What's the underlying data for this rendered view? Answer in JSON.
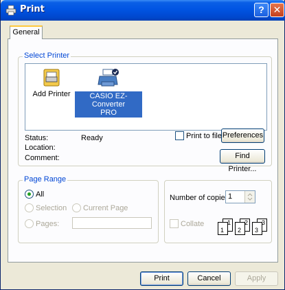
{
  "window": {
    "title": "Print",
    "help_glyph": "?",
    "close_glyph": "✕"
  },
  "tabs": [
    {
      "label": "General"
    }
  ],
  "select_printer": {
    "legend": "Select Printer",
    "printers": [
      {
        "name": "Add Printer",
        "icon": "add-printer-icon",
        "selected": false
      },
      {
        "name_line1": "CASIO EZ-Converter",
        "name_line2": "PRO",
        "icon": "printer-icon",
        "selected": true
      }
    ],
    "status_label": "Status:",
    "status_value": "Ready",
    "location_label": "Location:",
    "location_value": "",
    "comment_label": "Comment:",
    "comment_value": "",
    "print_to_file_label": "Print to file",
    "print_to_file_checked": false,
    "preferences_label": "Preferences",
    "find_printer_label": "Find Printer..."
  },
  "page_range": {
    "legend": "Page Range",
    "all_label": "All",
    "selection_label": "Selection",
    "current_page_label": "Current Page",
    "pages_label": "Pages:",
    "pages_value": ""
  },
  "copies": {
    "number_label": "Number of copies:",
    "number_value": "1",
    "collate_label": "Collate",
    "collate_checked": false,
    "collate_pages": [
      "1",
      "1",
      "2",
      "2",
      "3",
      "3"
    ]
  },
  "footer": {
    "print_label": "Print",
    "cancel_label": "Cancel",
    "apply_label": "Apply"
  },
  "colors": {
    "titlebar": "#0054e3",
    "selection": "#316ac5",
    "legend_text": "#0046d5",
    "dialog_bg": "#ece9d8"
  }
}
